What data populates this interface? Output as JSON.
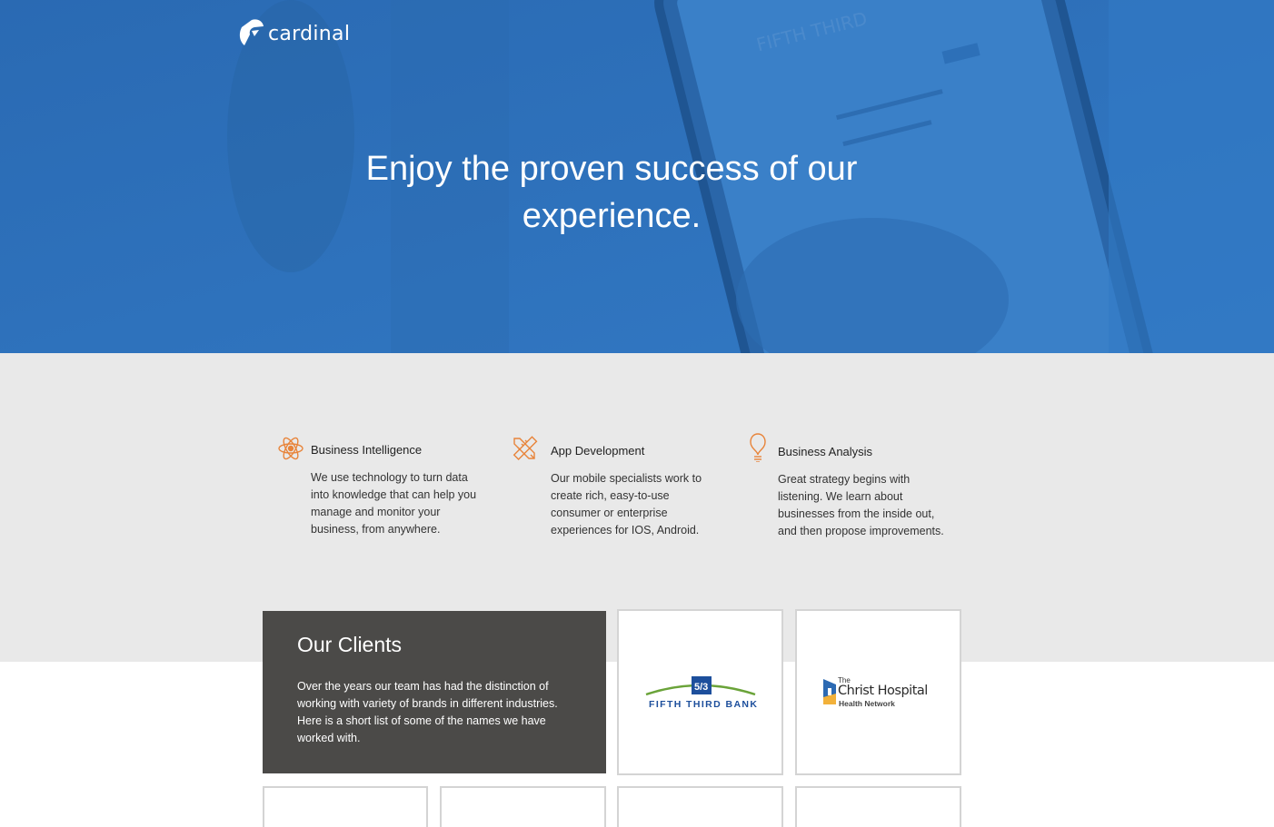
{
  "brand": {
    "name": "cardinal"
  },
  "hero": {
    "title": "Enjoy the proven success of our experience."
  },
  "services": [
    {
      "icon": "atom-icon",
      "title": "Business Intelligence",
      "description": "We use technology to turn data into knowledge that can help you manage and monitor your business, from anywhere."
    },
    {
      "icon": "pencil-ruler-icon",
      "title": "App Development",
      "description": "Our mobile specialists work to create rich, easy-to-use consumer or enterprise experiences for IOS, Android."
    },
    {
      "icon": "lightbulb-icon",
      "title": "Business Analysis",
      "description": "Great strategy begins with listening. We learn about businesses from the inside out, and then propose improvements."
    }
  ],
  "clients": {
    "title": "Our Clients",
    "description": "Over the years our team has had the distinction of working with variety of brands in different industries. Here is a short list of some of the names we have worked with.",
    "logos": [
      {
        "name": "FIFTH THIRD BANK"
      },
      {
        "the": "The",
        "name": "Christ Hospital",
        "sub": "Health Network"
      }
    ]
  },
  "colors": {
    "hero_blue": "#2e71b8",
    "services_bg": "#e9e9e9",
    "accent_orange": "#e8843a",
    "clients_box": "#4b4a48",
    "fifth_third_blue": "#1d4f9c",
    "fifth_third_green": "#6aa339"
  }
}
